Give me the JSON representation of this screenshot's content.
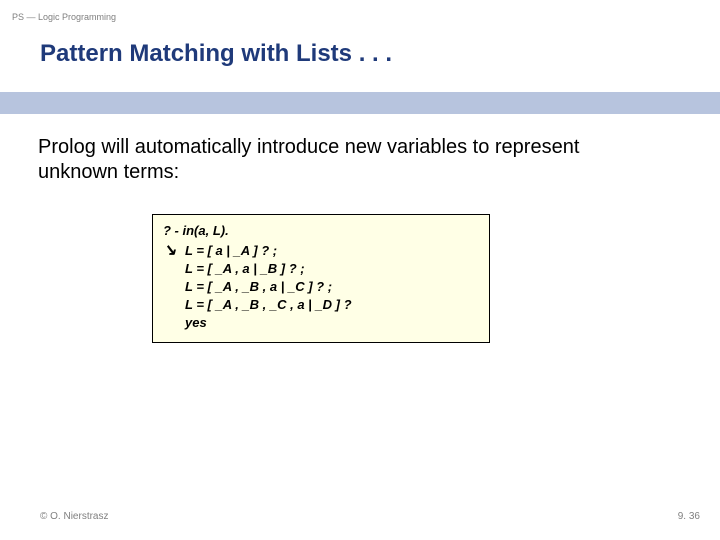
{
  "header": {
    "breadcrumb": "PS — Logic Programming"
  },
  "title": "Pattern Matching with Lists . . .",
  "body": {
    "paragraph": "Prolog will automatically introduce new variables to represent unknown terms:"
  },
  "code": {
    "query": "? - in(a, L).",
    "arrow": "↘",
    "result1": "L = [ a | _A ] ? ;",
    "result2": "L = [ _A , a | _B ] ? ;",
    "result3": "L = [ _A , _B , a | _C ] ? ;",
    "result4": "L = [ _A , _B , _C , a | _D ] ?",
    "result5": "yes"
  },
  "footer": {
    "copyright": "© O. Nierstrasz",
    "page_number": "9. 36"
  }
}
